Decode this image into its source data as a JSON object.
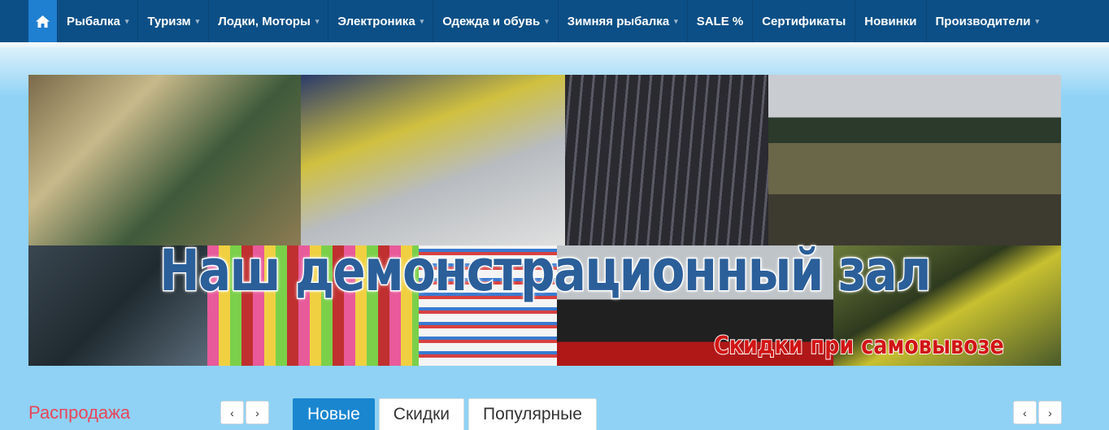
{
  "nav": {
    "home_icon": "home-icon",
    "items": [
      {
        "label": "Рыбалка",
        "dropdown": true
      },
      {
        "label": "Туризм",
        "dropdown": true
      },
      {
        "label": "Лодки, Моторы",
        "dropdown": true
      },
      {
        "label": "Электроника",
        "dropdown": true
      },
      {
        "label": "Одежда и обувь",
        "dropdown": true
      },
      {
        "label": "Зимняя рыбалка",
        "dropdown": true
      },
      {
        "label": "SALE %",
        "dropdown": false
      },
      {
        "label": "Сертификаты",
        "dropdown": false
      },
      {
        "label": "Новинки",
        "dropdown": false
      },
      {
        "label": "Производители",
        "dropdown": true
      }
    ],
    "caret": "▾"
  },
  "banner": {
    "title": "Наш демонстрационный зал",
    "subtitle": "Скидки при самовывозе"
  },
  "sale": {
    "title": "Распродажа",
    "prev": "‹",
    "next": "›"
  },
  "tabs": [
    {
      "label": "Новые",
      "active": true
    },
    {
      "label": "Скидки",
      "active": false
    },
    {
      "label": "Популярные",
      "active": false
    }
  ],
  "colors": {
    "nav_bg": "#0b4f86",
    "home_bg": "#1f7fd0",
    "page_bg": "#8fd2f5",
    "sale_title": "#e8455a",
    "tab_active": "#1a86d0",
    "banner_title": "#2b5f9a",
    "banner_sub": "#d11515"
  }
}
